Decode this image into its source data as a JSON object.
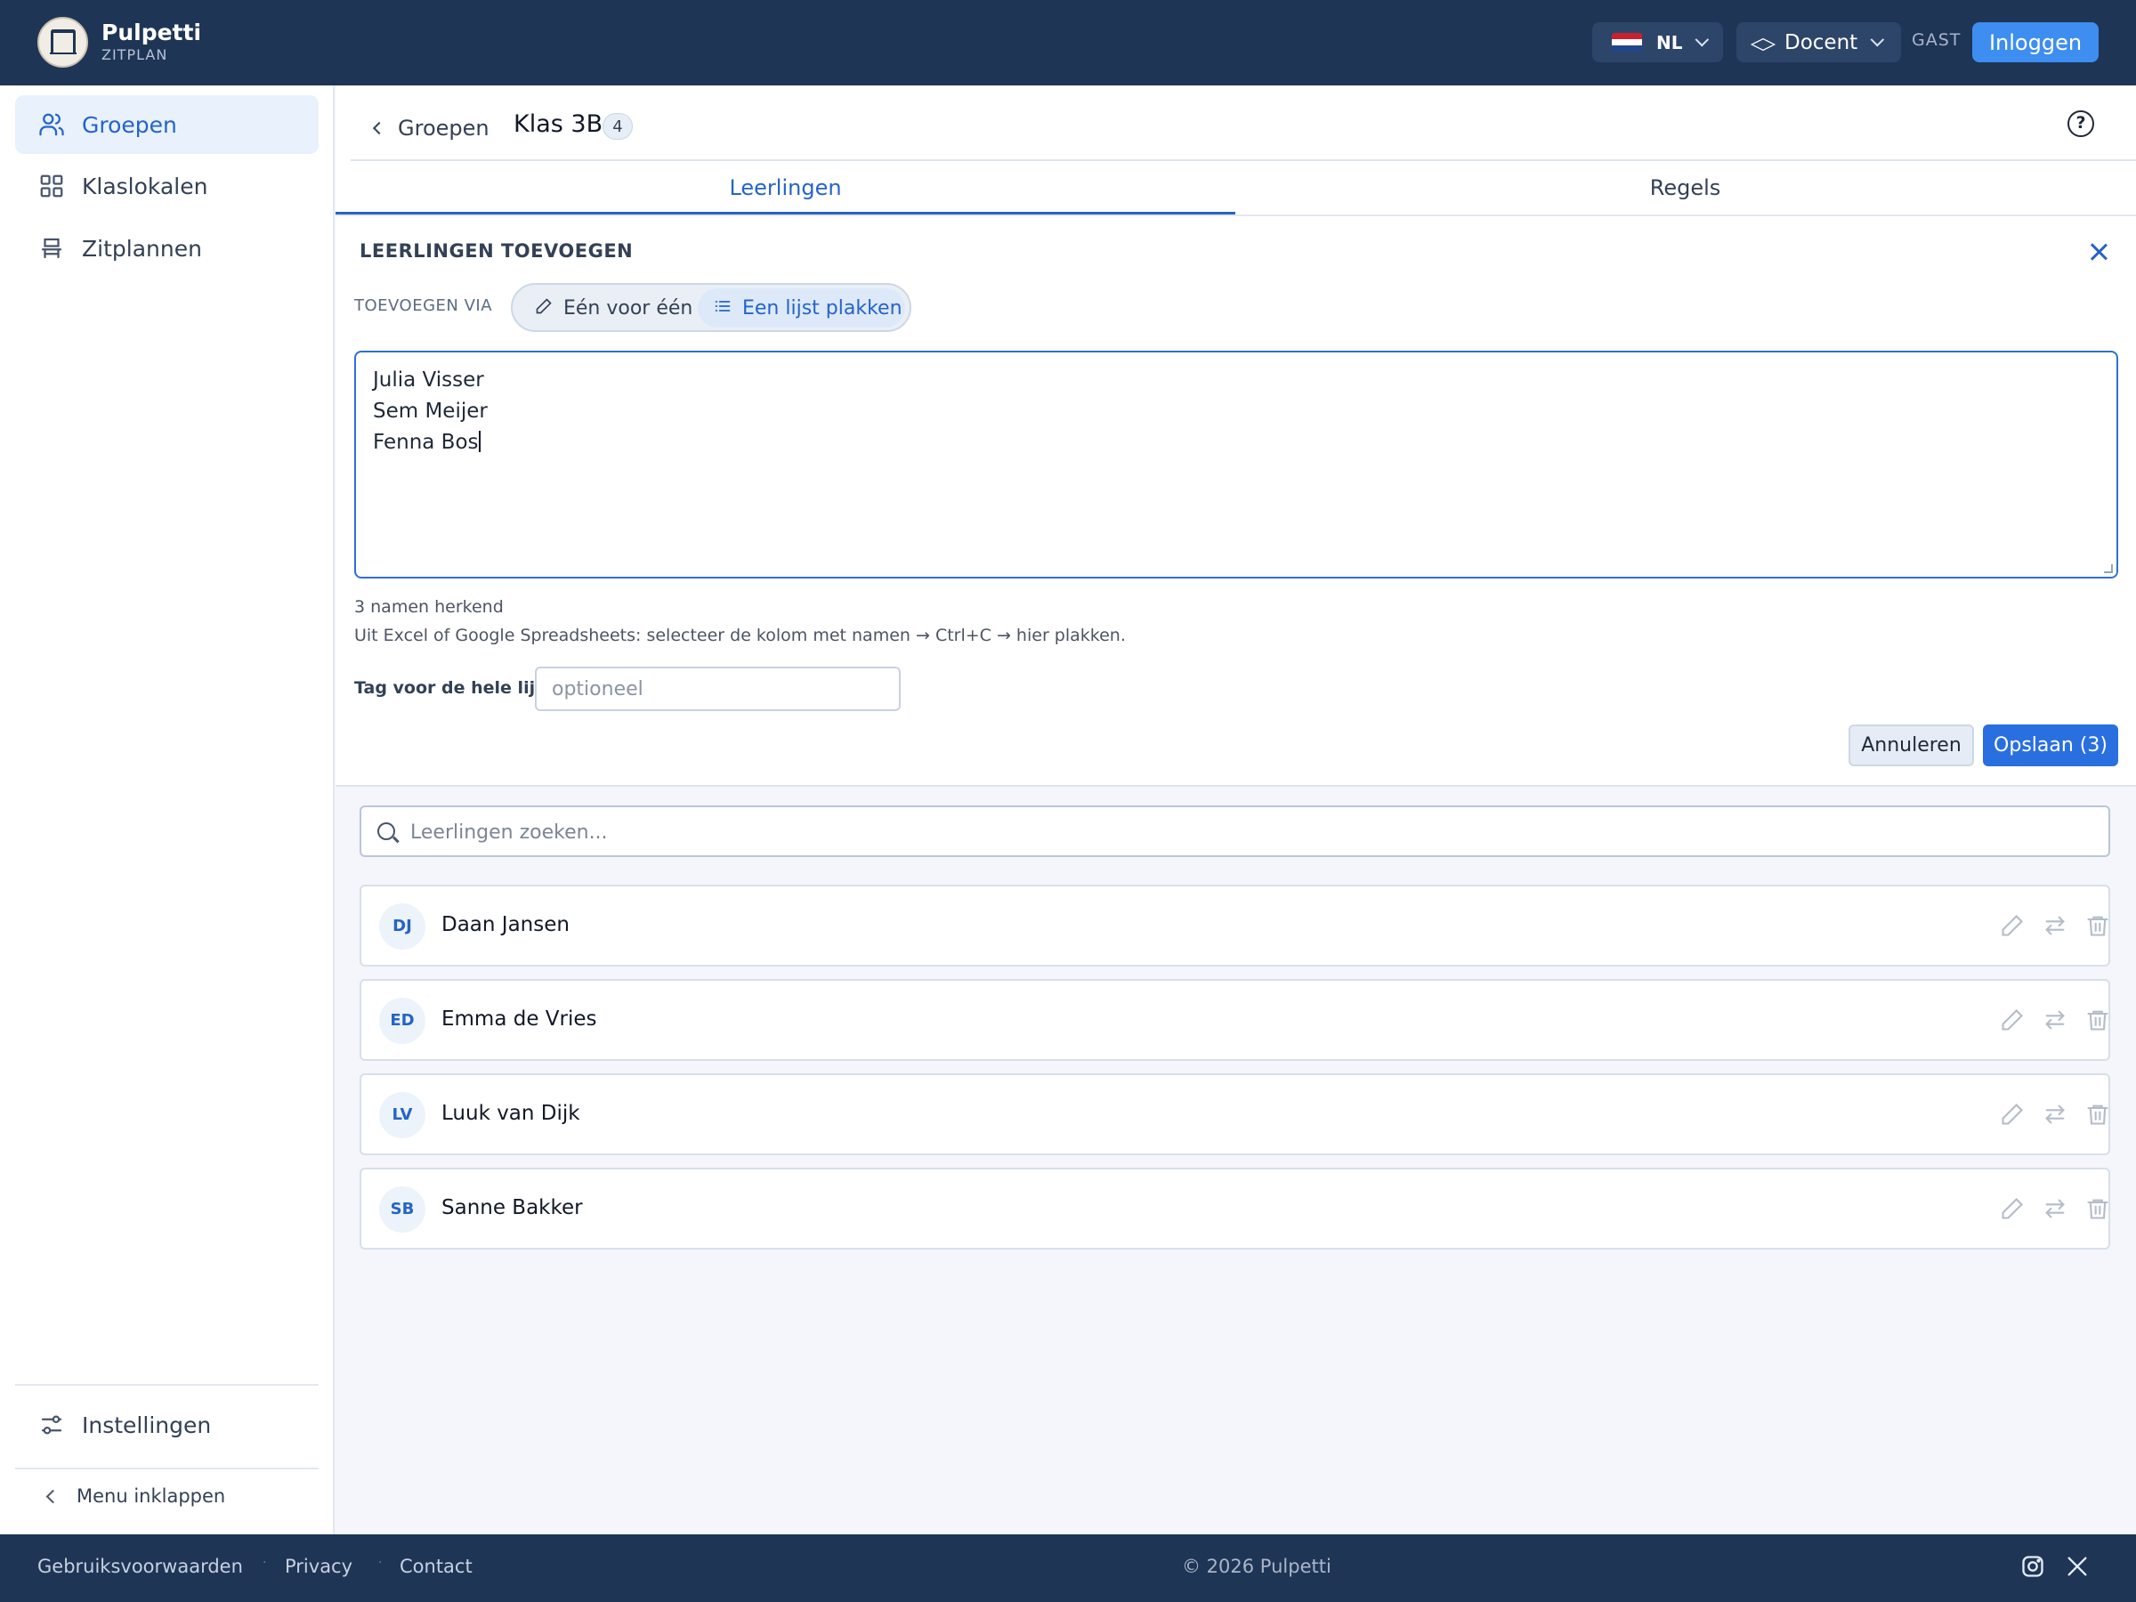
{
  "brand": {
    "name": "Pulpetti",
    "subtitle": "ZITPLAN"
  },
  "topbar": {
    "language": "NL",
    "role": "Docent",
    "guest_label": "GAST",
    "login_label": "Inloggen"
  },
  "sidebar": {
    "items": [
      {
        "label": "Groepen",
        "icon": "users-icon",
        "active": true
      },
      {
        "label": "Klaslokalen",
        "icon": "grid-icon",
        "active": false
      },
      {
        "label": "Zitplannen",
        "icon": "chair-icon",
        "active": false
      }
    ],
    "settings_label": "Instellingen",
    "collapse_label": "Menu inklappen"
  },
  "header": {
    "back_label": "Groepen",
    "group_name": "Klas 3B",
    "student_count": "4"
  },
  "tabs": [
    {
      "label": "Leerlingen",
      "active": true
    },
    {
      "label": "Regels",
      "active": false
    }
  ],
  "add_panel": {
    "title": "LEERLINGEN TOEVOEGEN",
    "via_label": "TOEVOEGEN VIA",
    "mode_single": "Eén voor één",
    "mode_list": "Een lijst plakken",
    "pasted_lines": [
      "Julia Visser",
      "Sem Meijer",
      "Fenna Bos"
    ],
    "recognized": "3 namen herkend",
    "hint": "Uit Excel of Google Spreadsheets: selecteer de kolom met namen → Ctrl+C → hier plakken.",
    "tag_label": "Tag voor de hele lijst",
    "tag_placeholder": "optioneel",
    "cancel_label": "Annuleren",
    "save_label": "Opslaan (3)"
  },
  "search": {
    "placeholder": "Leerlingen zoeken..."
  },
  "students": [
    {
      "initials": "DJ",
      "name": "Daan Jansen"
    },
    {
      "initials": "ED",
      "name": "Emma de Vries"
    },
    {
      "initials": "LV",
      "name": "Luuk van Dijk"
    },
    {
      "initials": "SB",
      "name": "Sanne Bakker"
    }
  ],
  "footer": {
    "links": [
      "Gebruiksvoorwaarden",
      "Privacy",
      "Contact"
    ],
    "separator": "·",
    "copyright": "© 2026 Pulpetti",
    "social": [
      "instagram-icon",
      "x-icon"
    ]
  },
  "colors": {
    "topbar": "#1e3556",
    "accent": "#2563c9",
    "login_button": "#3d8ef0",
    "save_button": "#2a6fe0"
  }
}
